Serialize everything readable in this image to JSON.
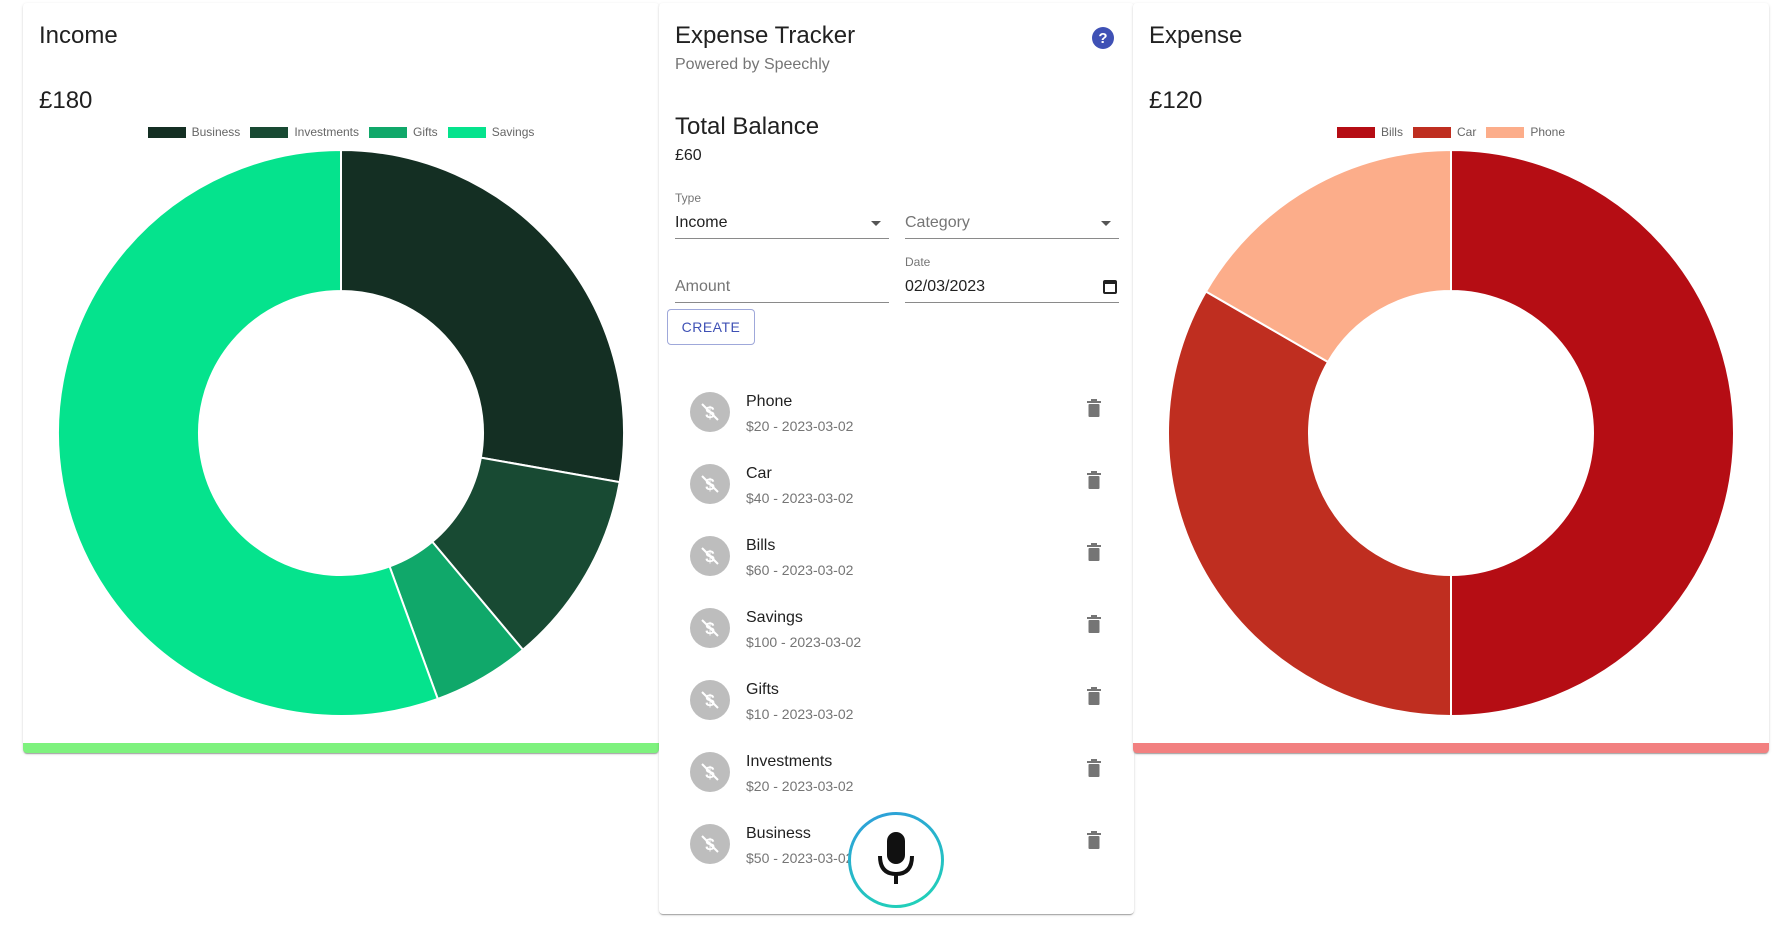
{
  "income": {
    "title": "Income",
    "amount": "£180",
    "accent_color": "#7ef27e",
    "chart_data": {
      "type": "pie",
      "categories": [
        "Business",
        "Investments",
        "Gifts",
        "Savings"
      ],
      "values": [
        50,
        20,
        10,
        100
      ],
      "colors": [
        "#142f23",
        "#184a33",
        "#10a86a",
        "#05e38d"
      ],
      "legend": "top"
    }
  },
  "expense": {
    "title": "Expense",
    "amount": "£120",
    "accent_color": "#f28080",
    "chart_data": {
      "type": "pie",
      "categories": [
        "Bills",
        "Car",
        "Phone"
      ],
      "values": [
        60,
        40,
        20
      ],
      "colors": [
        "#b50d14",
        "#bf2e20",
        "#fcad8a"
      ],
      "legend": "top"
    }
  },
  "tracker": {
    "title": "Expense Tracker",
    "subtitle": "Powered by Speechly",
    "help_icon": "question-circle-icon",
    "help_glyph": "?",
    "balance_title": "Total Balance",
    "balance_value": "£60",
    "form": {
      "type_label": "Type",
      "type_value": "Income",
      "category_placeholder": "Category",
      "amount_placeholder": "Amount",
      "date_label": "Date",
      "date_value": "02/03/2023",
      "create_label": "CREATE"
    },
    "transactions": [
      {
        "name": "Phone",
        "detail": "$20 - 2023-03-02"
      },
      {
        "name": "Car",
        "detail": "$40 - 2023-03-02"
      },
      {
        "name": "Bills",
        "detail": "$60 - 2023-03-02"
      },
      {
        "name": "Savings",
        "detail": "$100 - 2023-03-02"
      },
      {
        "name": "Gifts",
        "detail": "$10 - 2023-03-02"
      },
      {
        "name": "Investments",
        "detail": "$20 - 2023-03-02"
      },
      {
        "name": "Business",
        "detail": "$50 - 2023-03-02"
      }
    ]
  },
  "icons": {
    "avatar": "money-off-icon",
    "delete": "trash-icon",
    "mic": "microphone-icon"
  }
}
